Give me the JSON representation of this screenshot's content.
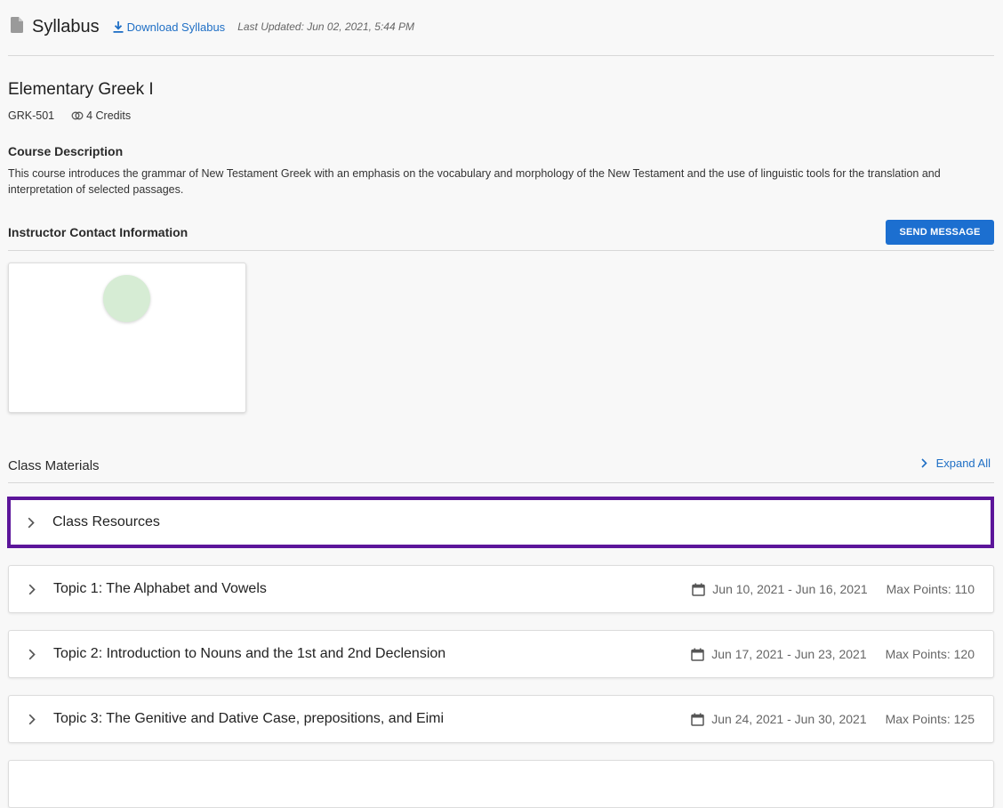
{
  "header": {
    "title": "Syllabus",
    "download_label": "Download Syllabus",
    "last_updated": "Last Updated: Jun 02, 2021, 5:44 PM"
  },
  "course": {
    "title": "Elementary Greek I",
    "code": "GRK-501",
    "credits": "4 Credits",
    "description_heading": "Course Description",
    "description": "This course introduces the grammar of New Testament Greek with an emphasis on the vocabulary and morphology of the New Testament and the use of linguistic tools for the translation and interpretation of selected passages."
  },
  "instructor": {
    "heading": "Instructor Contact Information",
    "send_label": "SEND MESSAGE",
    "avatar_color": "#d6ecd4"
  },
  "materials": {
    "heading": "Class Materials",
    "expand_label": "Expand All",
    "focus_color": "#5c159a",
    "panels": [
      {
        "title": "Class Resources",
        "dates": "",
        "points": ""
      },
      {
        "title": "Topic 1: The Alphabet and Vowels",
        "dates": "Jun 10, 2021 - Jun 16, 2021",
        "points": "Max Points: 110"
      },
      {
        "title": "Topic 2: Introduction to Nouns and the 1st and 2nd Declension",
        "dates": "Jun 17, 2021 - Jun 23, 2021",
        "points": "Max Points: 120"
      },
      {
        "title": "Topic 3: The Genitive and Dative Case, prepositions, and Eimi",
        "dates": "Jun 24, 2021 - Jun 30, 2021",
        "points": "Max Points: 125"
      }
    ]
  },
  "colors": {
    "accent": "#1c6fd0",
    "link": "#1f6fc5"
  }
}
